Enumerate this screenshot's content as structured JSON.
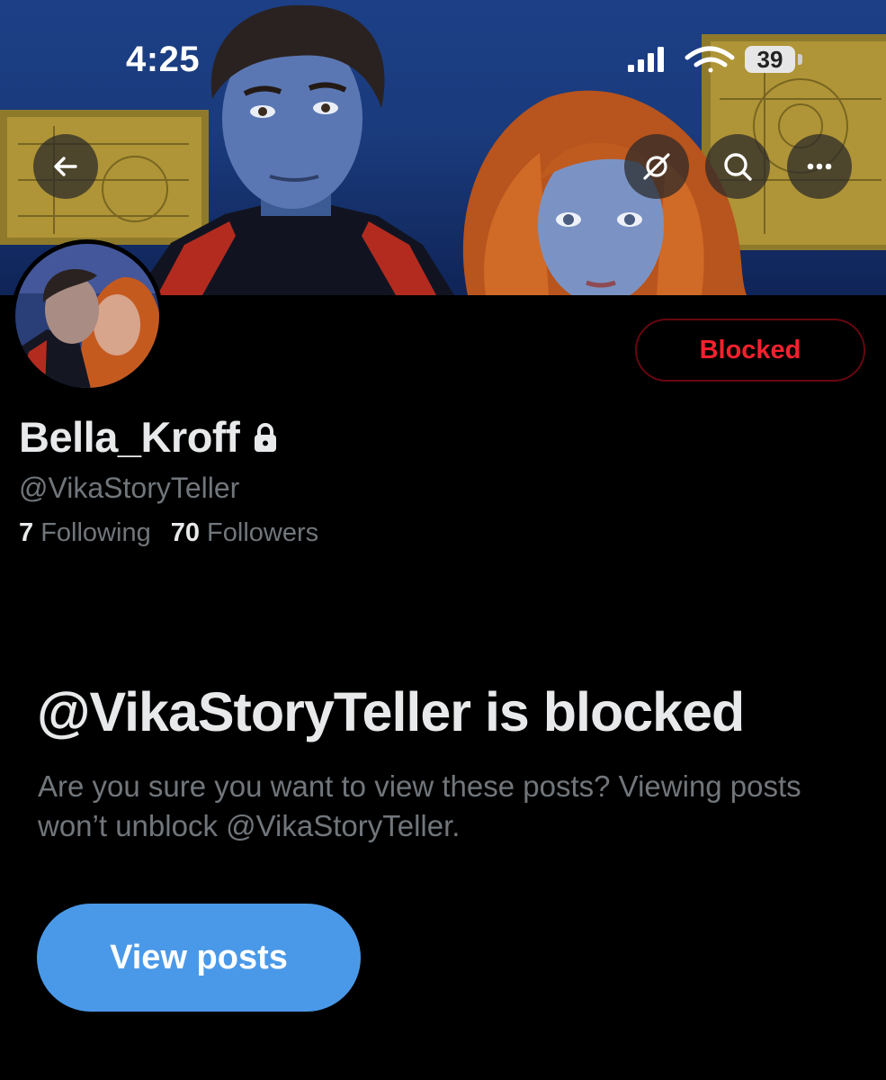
{
  "status_bar": {
    "time": "4:25",
    "battery": "39",
    "icons": [
      "cellular-signal-icon",
      "wifi-icon",
      "battery-icon"
    ]
  },
  "banner": {
    "buttons": [
      "back-arrow-icon",
      "grok-icon",
      "search-icon",
      "more-icon"
    ]
  },
  "profile": {
    "display_name": "Bella_Kroff",
    "handle": "@VikaStoryTeller",
    "following_count": "7",
    "following_label": "Following",
    "followers_count": "70",
    "followers_label": "Followers",
    "blocked_button_label": "Blocked",
    "protected": true
  },
  "blocked_notice": {
    "title": "@VikaStoryTeller is blocked",
    "description": "Are you sure you want to view these posts? Viewing posts won’t unblock @VikaStoryTeller.",
    "button_label": "View posts"
  },
  "colors": {
    "background": "#000000",
    "primary_text": "#e7e9ea",
    "secondary_text": "#71767b",
    "blocked_red": "#f4212e",
    "blocked_border": "#67070f",
    "accent_blue": "#4a99e9"
  }
}
